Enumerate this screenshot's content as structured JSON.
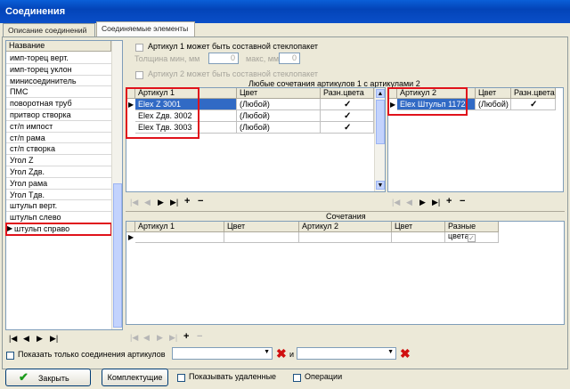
{
  "window": {
    "title": "Соединения"
  },
  "tabs": [
    "Описание соединений",
    "Соединяемые элементы"
  ],
  "left_list": {
    "header": "Название",
    "items": [
      "имп-торец верт.",
      "имп-торец уклон",
      "минисоединитель",
      "ПМС",
      "поворотная труб",
      "притвор створка",
      "ст/п импост",
      "ст/п рама",
      "ст/п створка",
      "Угол Z",
      "Угол Zдв.",
      "Угол рама",
      "Угол Тдв.",
      "штульп верт.",
      "штульп слево",
      "штульп справо"
    ],
    "selected": "штульп справо"
  },
  "options": {
    "art1_composite": "Артикул 1 может быть составной стеклопакет",
    "thickness_min_label": "Толщина мин, мм",
    "thickness_min": "0",
    "thickness_max_label": "макс, мм",
    "thickness_max": "0",
    "art2_composite": "Артикул 2 может быть составной стеклопакет"
  },
  "combo_caption": "Любые сочетания артикулов 1 с артикулами 2",
  "grid1": {
    "columns": [
      "Артикул 1",
      "Цвет",
      "Разн.цвета"
    ],
    "rows": [
      {
        "article": "Elex Z 3001",
        "color": "(Любой)",
        "diff": true
      },
      {
        "article": "Elex Zдв. 3002",
        "color": "(Любой)",
        "diff": true
      },
      {
        "article": "Elex Tдв. 3003",
        "color": "(Любой)",
        "diff": true
      }
    ]
  },
  "grid2": {
    "columns": [
      "Артикул 2",
      "Цвет",
      "Разн.цвета"
    ],
    "rows": [
      {
        "article": "Elex Штульп 1172",
        "color": "(Любой)",
        "diff": true
      }
    ]
  },
  "combos": {
    "caption": "Сочетания",
    "columns": [
      "Артикул 1",
      "Цвет",
      "Артикул 2",
      "Цвет",
      "Разные цвета"
    ]
  },
  "nav": {
    "first": "|◀",
    "prev": "◀",
    "next": "▶",
    "last": "▶|",
    "add": "+",
    "del": "−"
  },
  "filter": {
    "label": "Показать только соединения артикулов",
    "and": "и"
  },
  "bottom": {
    "close": "Закрыть",
    "complects": "Комплектущие",
    "show_deleted": "Показывать удаленные",
    "operations": "Операции"
  },
  "colors": {
    "title_blue": "#0a4fc9",
    "highlight": "#e0121b",
    "selection": "#316ac5"
  }
}
